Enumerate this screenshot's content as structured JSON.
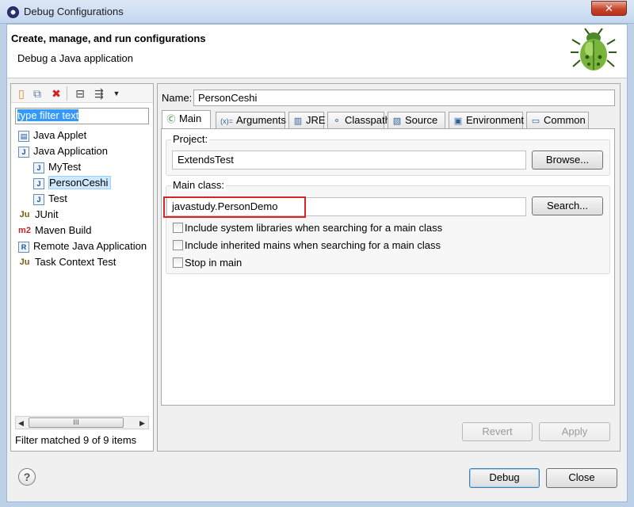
{
  "window": {
    "title": "Debug Configurations",
    "close_glyph": "✕"
  },
  "banner": {
    "title": "Create, manage, and run configurations",
    "subtitle": "Debug a Java application",
    "icon": "debug-bug-icon"
  },
  "left": {
    "filter_text": "type filter text",
    "tree": [
      {
        "label": "Java Applet",
        "icon": "applet-icon",
        "glyph": "▤"
      },
      {
        "label": "Java Application",
        "icon": "java-app-icon",
        "glyph": "J"
      },
      {
        "label": "MyTest",
        "icon": "java-launch-icon",
        "glyph": "J"
      },
      {
        "label": "PersonCeshi",
        "icon": "java-launch-icon",
        "glyph": "J",
        "selected": true
      },
      {
        "label": "Test",
        "icon": "java-launch-icon",
        "glyph": "J"
      },
      {
        "label": "JUnit",
        "icon": "junit-icon",
        "glyph": "Ju"
      },
      {
        "label": "Maven Build",
        "icon": "maven-icon",
        "glyph": "m2"
      },
      {
        "label": "Remote Java Application",
        "icon": "remote-java-icon",
        "glyph": "R"
      },
      {
        "label": "Task Context Test",
        "icon": "task-context-icon",
        "glyph": "Ju"
      }
    ],
    "scroll_grip": "III",
    "status": "Filter matched 9 of 9 items"
  },
  "right": {
    "name_label": "Name:",
    "name_value": "PersonCeshi",
    "tabs": [
      {
        "label": "Main",
        "glyph": "Ⓒ",
        "icon": "main-tab-icon"
      },
      {
        "label": "Arguments",
        "glyph": "(x)=",
        "icon": "arguments-icon"
      },
      {
        "label": "JRE",
        "glyph": "▥",
        "icon": "jre-icon"
      },
      {
        "label": "Classpath",
        "glyph": "⚬",
        "icon": "classpath-icon"
      },
      {
        "label": "Source",
        "glyph": "▧",
        "icon": "source-icon"
      },
      {
        "label": "Environment",
        "glyph": "▣",
        "icon": "environment-icon"
      },
      {
        "label": "Common",
        "glyph": "▭",
        "icon": "common-icon"
      }
    ],
    "project_label": "Project:",
    "project_value": "ExtendsTest",
    "browse_label": "Browse...",
    "main_class_label": "Main class:",
    "main_class_value": "javastudy.PersonDemo",
    "search_label": "Search...",
    "checkboxes": [
      {
        "label": "Include system libraries when searching for a main class",
        "checked": false
      },
      {
        "label": "Include inherited mains when searching for a main class",
        "checked": false
      },
      {
        "label": "Stop in main",
        "checked": false
      }
    ],
    "revert_label": "Revert",
    "apply_label": "Apply"
  },
  "footer": {
    "help_glyph": "?",
    "debug_label": "Debug",
    "close_label": "Close"
  }
}
